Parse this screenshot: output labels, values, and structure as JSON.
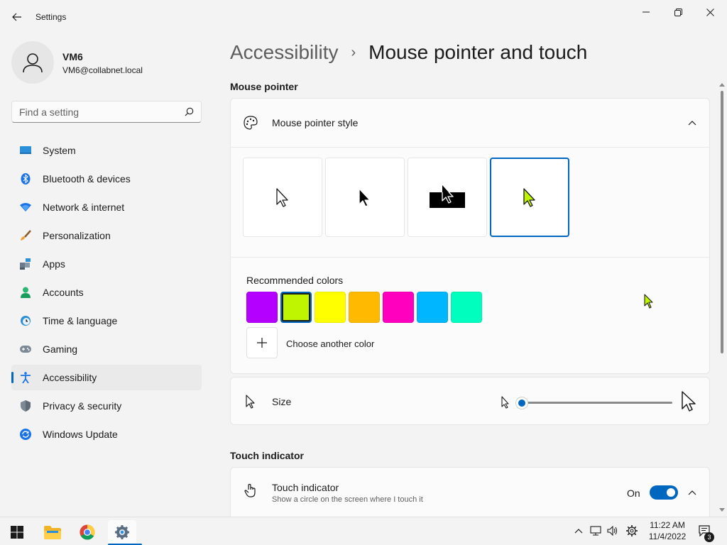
{
  "window": {
    "title": "Settings",
    "minimize": "minimize",
    "maximize": "maximize",
    "close": "close"
  },
  "profile": {
    "name": "VM6",
    "email": "VM6@collabnet.local"
  },
  "search": {
    "placeholder": "Find a setting"
  },
  "nav": {
    "items": [
      {
        "label": "System",
        "icon": "system-icon"
      },
      {
        "label": "Bluetooth & devices",
        "icon": "bluetooth-icon"
      },
      {
        "label": "Network & internet",
        "icon": "network-icon"
      },
      {
        "label": "Personalization",
        "icon": "brush-icon"
      },
      {
        "label": "Apps",
        "icon": "apps-icon"
      },
      {
        "label": "Accounts",
        "icon": "accounts-icon"
      },
      {
        "label": "Time & language",
        "icon": "time-icon"
      },
      {
        "label": "Gaming",
        "icon": "gaming-icon"
      },
      {
        "label": "Accessibility",
        "icon": "accessibility-icon",
        "selected": true
      },
      {
        "label": "Privacy & security",
        "icon": "shield-icon"
      },
      {
        "label": "Windows Update",
        "icon": "update-icon"
      }
    ]
  },
  "breadcrumb": {
    "parent": "Accessibility",
    "separator": "›",
    "current": "Mouse pointer and touch"
  },
  "mouse_pointer": {
    "section_title": "Mouse pointer",
    "style_label": "Mouse pointer style",
    "styles": [
      "white",
      "black",
      "inverted",
      "custom"
    ],
    "selected_style": "custom",
    "recommended_label": "Recommended colors",
    "colors": [
      "#b400ff",
      "#bff500",
      "#ffff00",
      "#ffb900",
      "#ff00bf",
      "#00b7ff",
      "#00ffbf"
    ],
    "selected_color": "#bff500",
    "choose_color_label": "Choose another color",
    "size_label": "Size",
    "size_value": 0
  },
  "touch_indicator": {
    "section_title": "Touch indicator",
    "label": "Touch indicator",
    "description": "Show a circle on the screen where I touch it",
    "state_label": "On",
    "on": true
  },
  "taskbar": {
    "time": "11:22 AM",
    "date": "11/4/2022",
    "notification_count": "3"
  },
  "colors": {
    "accent": "#0067c0"
  }
}
